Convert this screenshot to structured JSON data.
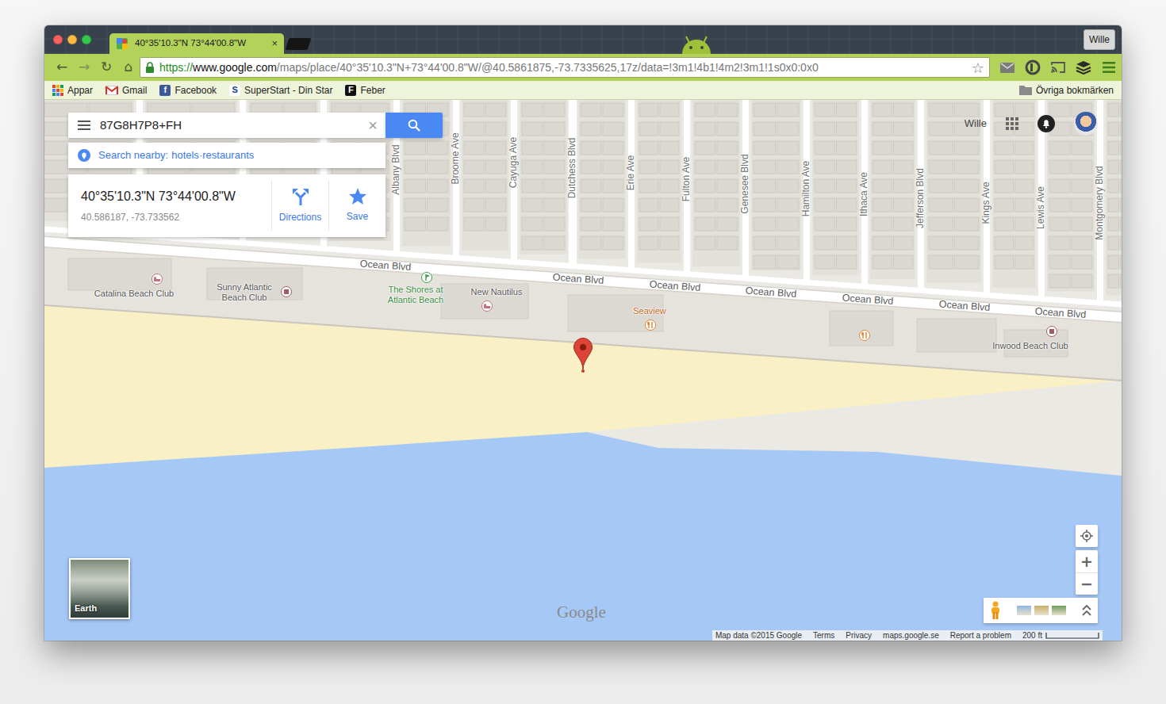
{
  "browser": {
    "traffic_lights": [
      {
        "color": "#fc605c"
      },
      {
        "color": "#fdbc40"
      },
      {
        "color": "#34c84a"
      }
    ],
    "tabs": [
      {
        "title": "40°35'10.3\"N 73°44'00.8\"W",
        "close": "×",
        "selected": true
      }
    ],
    "profile": "Wille",
    "nav_buttons": [
      "←",
      "→",
      "↻",
      "⌂"
    ],
    "url": {
      "scheme": "https://",
      "host": "www.google.com",
      "path": "/maps/place/40°35'10.3\"N+73°44'00.8\"W/@40.5861875,-73.7335625,17z/data=!3m1!4b1!4m2!3m1!1s0x0:0x0"
    },
    "bookmark_star": "☆",
    "bookmarks": [
      {
        "label": "Appar",
        "kind": "apps"
      },
      {
        "label": "Gmail",
        "kind": "mail"
      },
      {
        "label": "Facebook",
        "kind": "letter",
        "icon": "f",
        "color": "#3b5998"
      },
      {
        "label": "SuperStart - Din Star",
        "kind": "letter",
        "icon": "S",
        "color": "#ffffff"
      },
      {
        "label": "Feber",
        "kind": "letter",
        "icon": "F",
        "color": "#111111"
      }
    ],
    "other_bookmarks": "Övriga bokmärken"
  },
  "maps": {
    "search": {
      "value": "87G8H7P8+FH",
      "clear": "×"
    },
    "nearby": {
      "label": "Search nearby:",
      "items": [
        "hotels",
        "restaurants"
      ],
      "separator": "·"
    },
    "place": {
      "title": "40°35'10.3\"N 73°44'00.8\"W",
      "coords": "40.586187, -73.733562",
      "actions": [
        "Directions",
        "Save"
      ]
    },
    "account": {
      "name": "Wille"
    },
    "streets": [
      "Albany Blvd",
      "Broome Ave",
      "Cayuga Ave",
      "Dutchess Blvd",
      "Erie Ave",
      "Fulton Ave",
      "Genesee Blvd",
      "Hamilton Ave",
      "Ithaca Ave",
      "Jefferson Blvd",
      "Kings Ave",
      "Lewis Ave",
      "Montgomery Blvd"
    ],
    "roads": [
      "Ocean Blvd",
      "Ocean Blvd",
      "Ocean Blvd",
      "Ocean Blvd",
      "Ocean Blvd",
      "Ocean Blvd",
      "Ocean Blvd"
    ],
    "places": [
      {
        "name": "Catalina Beach Club",
        "kind": "hotel",
        "color": "#c2707c"
      },
      {
        "name": "Sunny Atlantic Beach Club",
        "kind": "bar",
        "color": "#9e5b68"
      },
      {
        "name": "The Shores at Atlantic Beach",
        "kind": "golf",
        "color": "#3f9b46"
      },
      {
        "name": "New Nautilus",
        "kind": "hotel",
        "color": "#c2707c"
      },
      {
        "name": "Seaview",
        "kind": "restaurant",
        "color": "#e0822d"
      },
      {
        "kind": "restaurant",
        "color": "#e0822d"
      },
      {
        "name": "Inwood Beach Club",
        "kind": "bar",
        "color": "#9e5b68"
      }
    ],
    "earth": "Earth",
    "zoom": [
      "+",
      "−"
    ],
    "logo": "Google",
    "footer": [
      "Map data ©2015 Google",
      "Terms",
      "Privacy",
      "maps.google.se",
      "Report a problem"
    ],
    "scale": "200 ft"
  }
}
